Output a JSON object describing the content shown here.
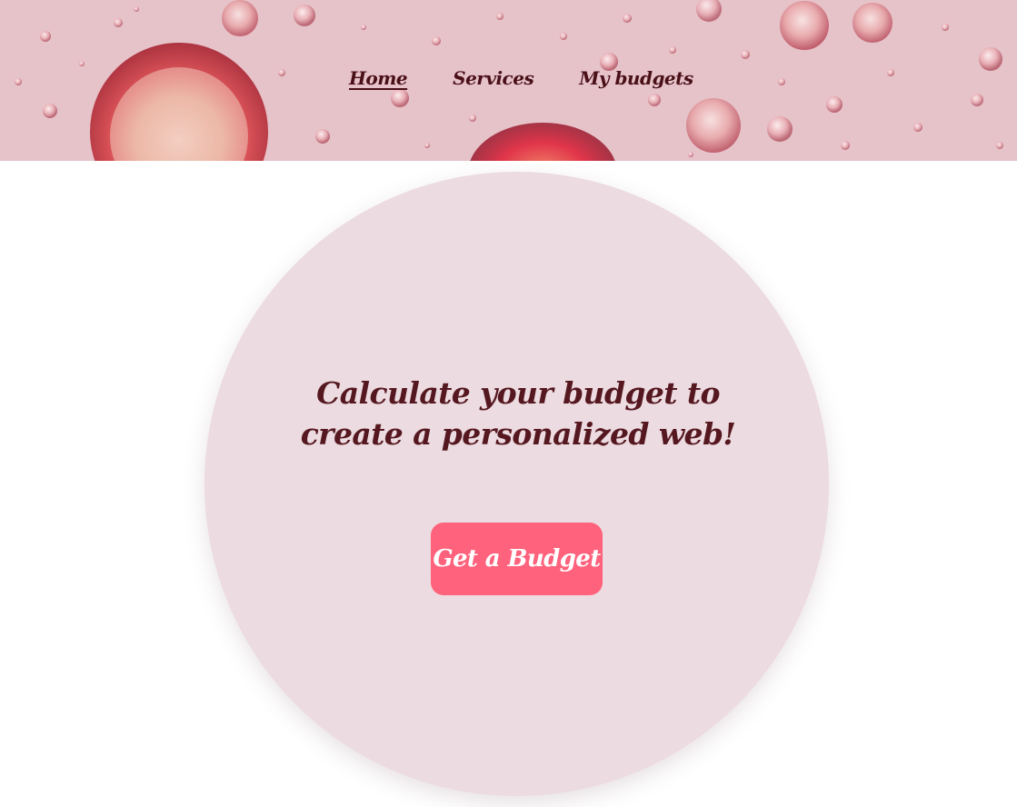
{
  "nav": {
    "items": [
      {
        "label": "Home",
        "active": true
      },
      {
        "label": "Services",
        "active": false
      },
      {
        "label": "My budgets",
        "active": false
      }
    ]
  },
  "hero": {
    "headline": "Calculate your budget to create a personalized web!",
    "cta_label": "Get a Budget"
  },
  "colors": {
    "banner_bg": "#e6bfc8",
    "nav_text": "#4a1018",
    "circle_bg": "#ecdbe0",
    "headline_text": "#561820",
    "button_bg": "#ff627c",
    "button_text": "#ffffff"
  },
  "banner": {
    "image": "pink-bubbles-background"
  }
}
